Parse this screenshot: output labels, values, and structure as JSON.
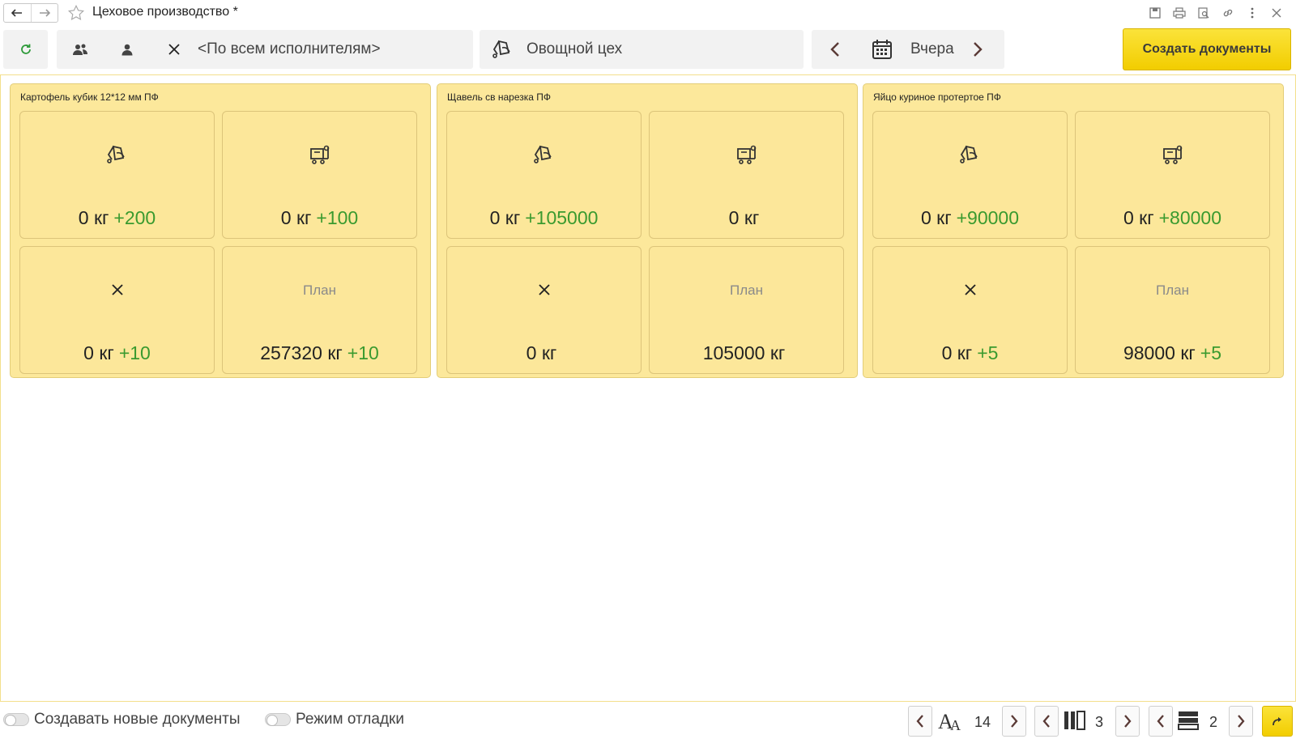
{
  "window": {
    "title": "Цеховое производство *"
  },
  "toolbar": {
    "executors_text": "<По всем исполнителям>",
    "workshop_text": "Овощной цех",
    "date_text": "Вчера",
    "create_button": "Создать документы"
  },
  "cards": [
    {
      "title": "Картофель кубик 12*12 мм ПФ",
      "tiles": [
        {
          "icon": "bucket-icon",
          "value": "0 кг",
          "plus": "+200"
        },
        {
          "icon": "cart-icon",
          "value": "0 кг",
          "plus": "+100"
        },
        {
          "icon": "cross-icon",
          "value": "0 кг",
          "plus": "+10"
        },
        {
          "label": "План",
          "value": "257320 кг",
          "plus": "+10"
        }
      ]
    },
    {
      "title": "Щавель св нарезка ПФ",
      "tiles": [
        {
          "icon": "bucket-icon",
          "value": "0 кг",
          "plus": "+105000"
        },
        {
          "icon": "cart-icon",
          "value": "0 кг",
          "plus": ""
        },
        {
          "icon": "cross-icon",
          "value": "0 кг",
          "plus": ""
        },
        {
          "label": "План",
          "value": "105000 кг",
          "plus": ""
        }
      ]
    },
    {
      "title": "Яйцо куриное протертое ПФ",
      "tiles": [
        {
          "icon": "bucket-icon",
          "value": "0 кг",
          "plus": "+90000"
        },
        {
          "icon": "cart-icon",
          "value": "0 кг",
          "plus": "+80000"
        },
        {
          "icon": "cross-icon",
          "value": "0 кг",
          "plus": "+5"
        },
        {
          "label": "План",
          "value": "98000 кг",
          "plus": "+5"
        }
      ]
    }
  ],
  "bottom": {
    "toggle_new_docs": "Создавать новые документы",
    "toggle_debug": "Режим отладки",
    "font_size": "14",
    "columns": "3",
    "rows": "2"
  },
  "colors": {
    "accent": "#f5d21a",
    "card_bg": "#fce89b",
    "plus_green": "#3a9a2f",
    "refresh_green": "#2e9a3a"
  }
}
